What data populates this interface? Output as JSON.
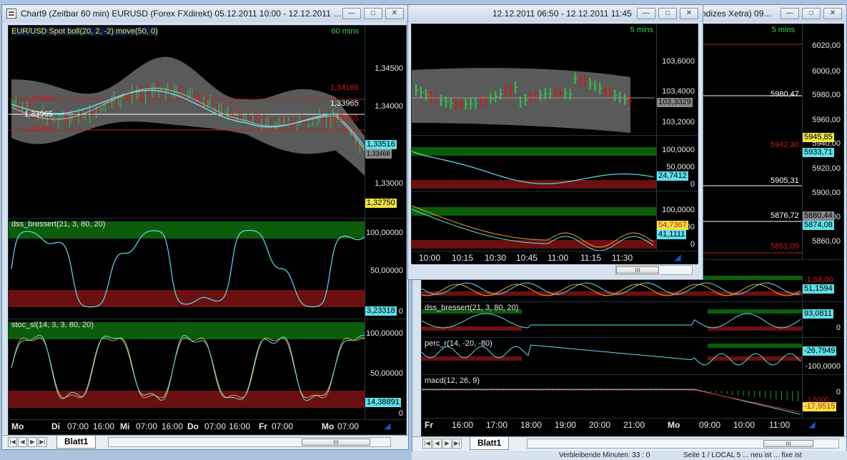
{
  "windows": {
    "chart9": {
      "title": "Chart9 (Zeitbar 60 min)  EURUSD (Forex FXdirekt) 05.12.2011 10:00 - 12.12.2011 11...",
      "timeframe": "60 mins",
      "price": {
        "header": "EUR/USD Spot boll(20, 2, -2) move(50, 0)",
        "ticks": [
          "1,34500",
          "1,34000",
          "1,33000"
        ],
        "level_labels_left": [
          "1,34166",
          "1,33965",
          "1,33755"
        ],
        "level_labels_right": [
          "1,34166",
          "1,33965",
          "1,33755"
        ],
        "flag_cyan": "1,33516",
        "flag_cyan_sub": "1,33468",
        "flag_yellow": "1,32750"
      },
      "dss": {
        "header": "dss_bressert(21, 3, 80, 20)",
        "ticks": [
          "100,00000",
          "50,00000",
          "0"
        ],
        "flag": "3,23318"
      },
      "stoc": {
        "header": "stoc_sl(14, 3, 3, 80, 20)",
        "ticks": [
          "100,00000",
          "50,00000",
          "0"
        ],
        "flag": "14,38891"
      },
      "xaxis": [
        "Mo",
        "Di",
        "07:00",
        "16:00",
        "Mi",
        "07:00",
        "16:00",
        "Do",
        "07:00",
        "16:00",
        "Fr",
        "07:00",
        "Mo",
        "07:00"
      ],
      "tab": "Blatt1",
      "scroll_thumb": "III"
    },
    "middle": {
      "title": "12.12.2011 06:50 - 12.12.2011 11:45",
      "timeframe": "5 mins",
      "price": {
        "ticks": [
          "103,6000",
          "103,4000",
          "103,2000"
        ],
        "flag": "103,3329"
      },
      "osc1": {
        "ticks": [
          "100,0000",
          "50,0000",
          "0"
        ],
        "flag": "24,7412"
      },
      "osc2": {
        "ticks": [
          "100,0000",
          "50,0000",
          "0"
        ],
        "flag_red": "54,7367",
        "flag_cyan": "41,1111"
      },
      "xaxis": [
        "10:00",
        "10:15",
        "10:30",
        "10:45",
        "11:00",
        "11:15",
        "11:30"
      ],
      "scroll_thumb": "III"
    },
    "right": {
      "title": "ndizes Xetra) 09...",
      "timeframe": "5 mins",
      "price": {
        "ticks": [
          "6020,00",
          "6000,00",
          "5980,00",
          "5960,00",
          "5940,00",
          "5920,00",
          "5900,00",
          "5880,00",
          "5860,00"
        ],
        "labels_white": [
          "5980,47",
          "5905,31",
          "5876,72"
        ],
        "label_red": "5942,30",
        "label_red2": "5851,09",
        "flag_yellow": "5945,85",
        "flag_cyan": "5933,71",
        "flag_green": "5874,08",
        "flag_grey": "5880,44"
      },
      "osc0": {
        "flag": "51,1594",
        "flag_partial": "-1,58,00"
      },
      "dss": {
        "header": "dss_bressert(21, 3, 80, 20)",
        "flag": "93,0811",
        "tick0": "0"
      },
      "perc": {
        "header": "perc_r(14, -20, -80)",
        "flag": "-26,7949",
        "tick": "-100,0000"
      },
      "macd": {
        "header": "macd(12, 26, 9)",
        "tick0": "0",
        "tick1": "0",
        "flag_yellow": "-17,9515"
      },
      "xaxis": [
        "Fr",
        "16:00",
        "17:00",
        "18:00",
        "19:00",
        "20:00",
        "21:00",
        "Mo",
        "09:00",
        "10:00",
        "11:00"
      ],
      "tab": "Blatt1",
      "scroll_thumb": "III"
    }
  },
  "statusbar": {
    "left": "Verbleibende Minuten: 33 : 0",
    "right": "Seite 1 / LOCAL 5 ... neu ist  ... fixe ist"
  },
  "colors": {
    "bull": "#33c24a",
    "bear": "#d11a1a",
    "band": "#5a5a5a",
    "cyan": "#5fe0ea",
    "overbought": "#0c5c0c",
    "oversold": "#6a1010"
  }
}
